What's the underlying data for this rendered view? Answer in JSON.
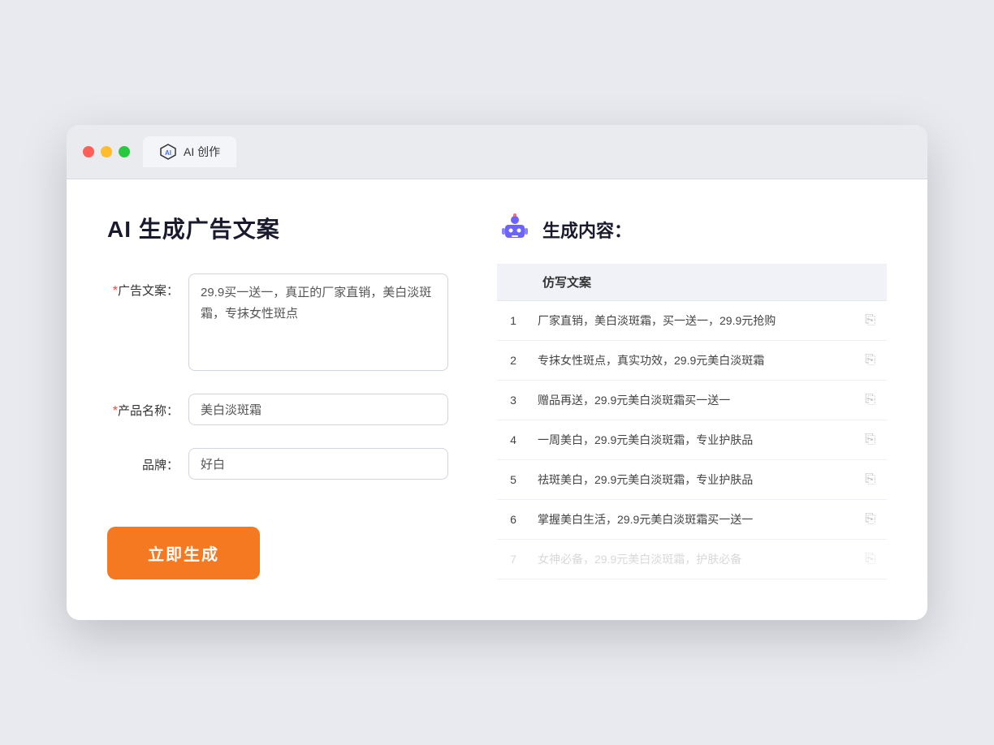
{
  "browser": {
    "tab_label": "AI 创作",
    "traffic_lights": [
      "red",
      "yellow",
      "green"
    ]
  },
  "left": {
    "page_title": "AI 生成广告文案",
    "form": {
      "ad_copy_label": "广告文案：",
      "ad_copy_required": "*",
      "ad_copy_value": "29.9买一送一，真正的厂家直销，美白淡斑霜，专抹女性斑点",
      "product_name_label": "产品名称：",
      "product_name_required": "*",
      "product_name_value": "美白淡斑霜",
      "brand_label": "品牌：",
      "brand_value": "好白"
    },
    "generate_btn": "立即生成"
  },
  "right": {
    "header_title": "生成内容：",
    "table": {
      "column_header": "仿写文案",
      "rows": [
        {
          "num": 1,
          "text": "厂家直销，美白淡斑霜，买一送一，29.9元抢购"
        },
        {
          "num": 2,
          "text": "专抹女性斑点，真实功效，29.9元美白淡斑霜"
        },
        {
          "num": 3,
          "text": "赠品再送，29.9元美白淡斑霜买一送一"
        },
        {
          "num": 4,
          "text": "一周美白，29.9元美白淡斑霜，专业护肤品"
        },
        {
          "num": 5,
          "text": "祛斑美白，29.9元美白淡斑霜，专业护肤品"
        },
        {
          "num": 6,
          "text": "掌握美白生活，29.9元美白淡斑霜买一送一"
        },
        {
          "num": 7,
          "text": "女神必备，29.9元美白淡斑霜，护肤必备",
          "faded": true
        }
      ]
    }
  }
}
